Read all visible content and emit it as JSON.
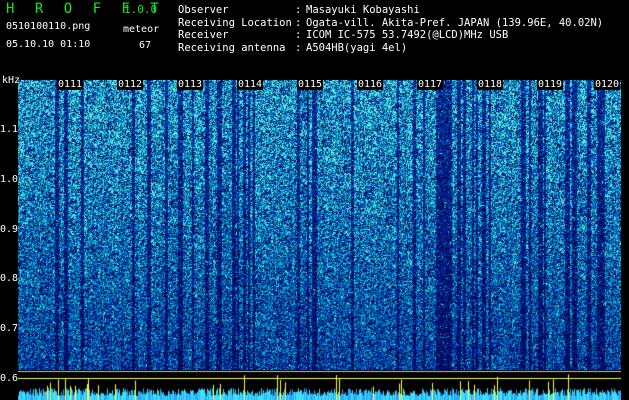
{
  "header": {
    "app_title": "H R O F F T",
    "version": "1.0.0",
    "filename": "0510100110.png",
    "datetime": "05.10.10 01:10",
    "meteor_label": "meteor",
    "meteor_count": "67"
  },
  "info": {
    "labels": [
      "Observer",
      "Receiving Location",
      "Receiver",
      "Receiving antenna"
    ],
    "colons": [
      ":",
      ":",
      ":",
      ":"
    ],
    "values": [
      "Masayuki Kobayashi",
      "Ogata-vill. Akita-Pref. JAPAN (139.96E, 40.02N)",
      "ICOM IC-575 53.7492(@LCD)MHz USB",
      "A504HB(yagi 4el)"
    ]
  },
  "axis": {
    "unit": "kHz",
    "y_labels": [
      "1.1",
      "1.0",
      "0.9",
      "0.8",
      "0.7",
      "0.6"
    ],
    "time_labels": [
      "0111",
      "0112",
      "0113",
      "0114",
      "0115",
      "0116",
      "0117",
      "0118",
      "0119",
      "0120"
    ]
  },
  "colors": {
    "title_green": "#19e619",
    "background": "#000000",
    "spectrogram_low": "#0a1a8c",
    "spectrogram_high": "#30e0ff",
    "marker_yellow": "#ffff40"
  }
}
